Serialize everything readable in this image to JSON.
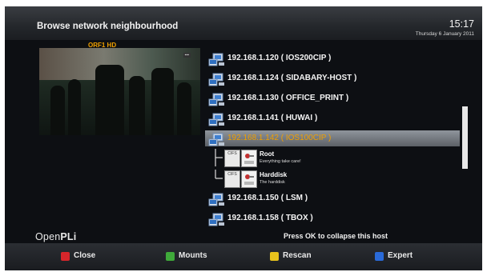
{
  "header": {
    "title": "Browse network neighbourhood",
    "time": "15:17",
    "date": "Thursday 6 January 2011"
  },
  "preview": {
    "channel": "ORF1 HD"
  },
  "hosts": [
    {
      "label": "192.168.1.120 ( IOS200CIP )",
      "icon": "network-pc-icon"
    },
    {
      "label": "192.168.1.124 ( SIDABARY-HOST )",
      "icon": "network-pc-icon"
    },
    {
      "label": "192.168.1.130 ( OFFICE_PRINT )",
      "icon": "network-pc-icon"
    },
    {
      "label": "192.168.1.141 ( HUWAI )",
      "icon": "network-pc-icon"
    },
    {
      "label": "192.168.1.142 ( IOS100CIP )",
      "icon": "network-pc-icon",
      "selected": true
    },
    {
      "label": "192.168.1.150 ( LSM )",
      "icon": "network-pc-icon"
    },
    {
      "label": "192.168.1.158 ( TBOX )",
      "icon": "network-pc-icon"
    }
  ],
  "shares": [
    {
      "name": "Root",
      "description": "Everything  take care!",
      "type": "CIFS",
      "icon": "share-drive-icon"
    },
    {
      "name": "Harddisk",
      "description": "The harddisk",
      "type": "CIFS",
      "icon": "share-drive-icon"
    }
  ],
  "footer": {
    "brand_open": "Open",
    "brand_pli": "PLi",
    "hint": "Press OK to collapse this host"
  },
  "buttons": [
    {
      "label": "Close",
      "color": "#d6262b"
    },
    {
      "label": "Mounts",
      "color": "#3faa3a"
    },
    {
      "label": "Rescan",
      "color": "#e8c21c"
    },
    {
      "label": "Expert",
      "color": "#2a6ad8"
    }
  ]
}
